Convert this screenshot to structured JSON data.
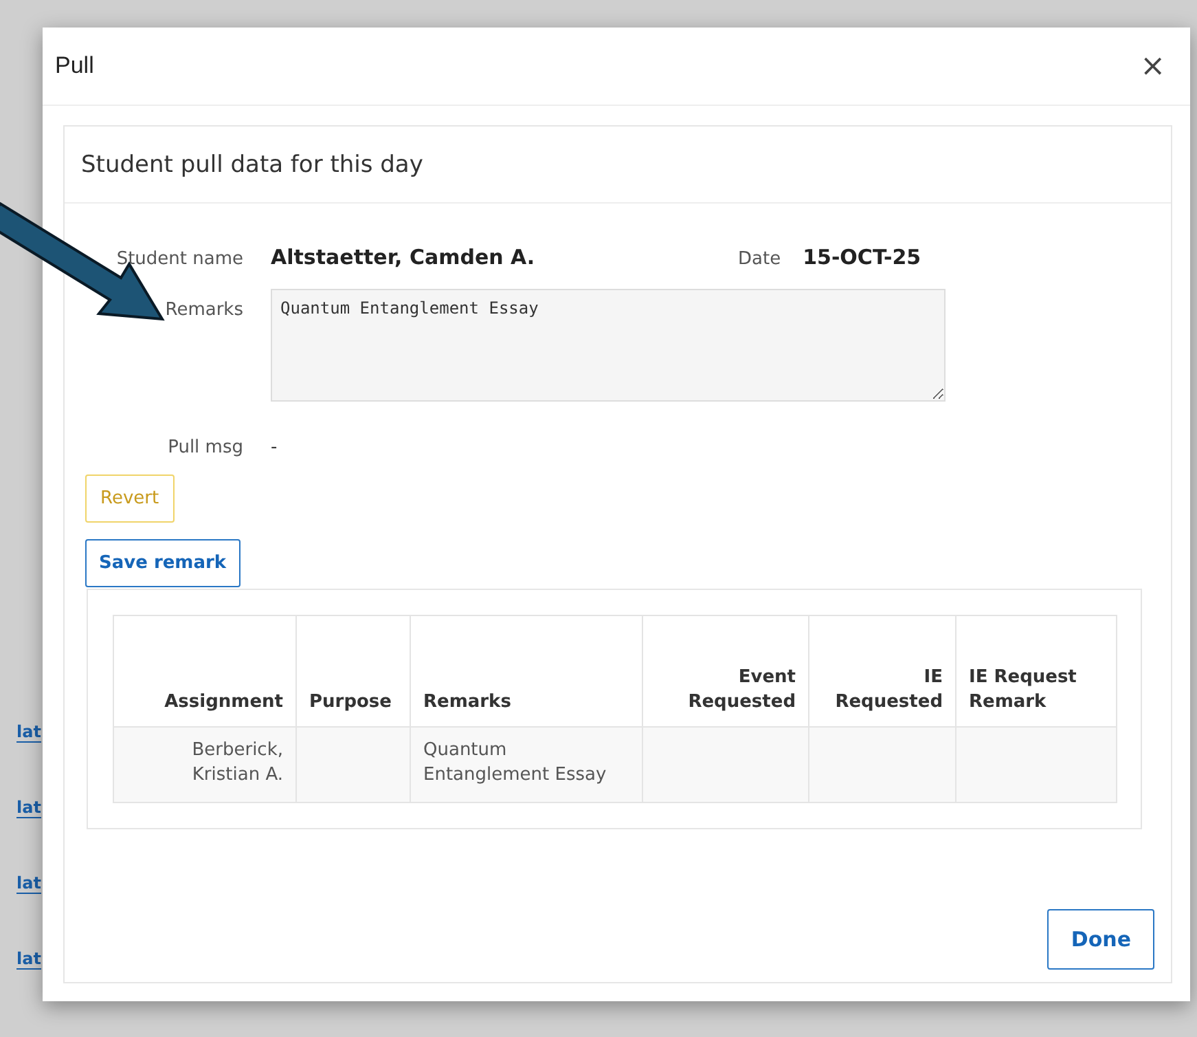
{
  "background": {
    "links": [
      "lat",
      "lat",
      "lat",
      "lat"
    ]
  },
  "dialog": {
    "title": "Pull",
    "close": "×",
    "panel_title": "Student pull data for this day",
    "fields": {
      "student_name_label": "Student name",
      "student_name": "Altstaetter, Camden A.",
      "date_label": "Date",
      "date": "15-OCT-25",
      "remarks_label": "Remarks",
      "remarks": "Quantum Entanglement Essay",
      "pull_msg_label": "Pull msg",
      "pull_msg": "-"
    },
    "buttons": {
      "revert": "Revert",
      "save": "Save remark",
      "done": "Done"
    },
    "table": {
      "columns": [
        "Assignment",
        "Purpose",
        "Remarks",
        "Event Requested",
        "IE Requested",
        "IE Request Remark"
      ],
      "rows": [
        {
          "cells": [
            "Berberick, Kristian A.",
            "",
            "Quantum Entanglement Essay",
            "",
            "",
            ""
          ]
        }
      ]
    }
  }
}
